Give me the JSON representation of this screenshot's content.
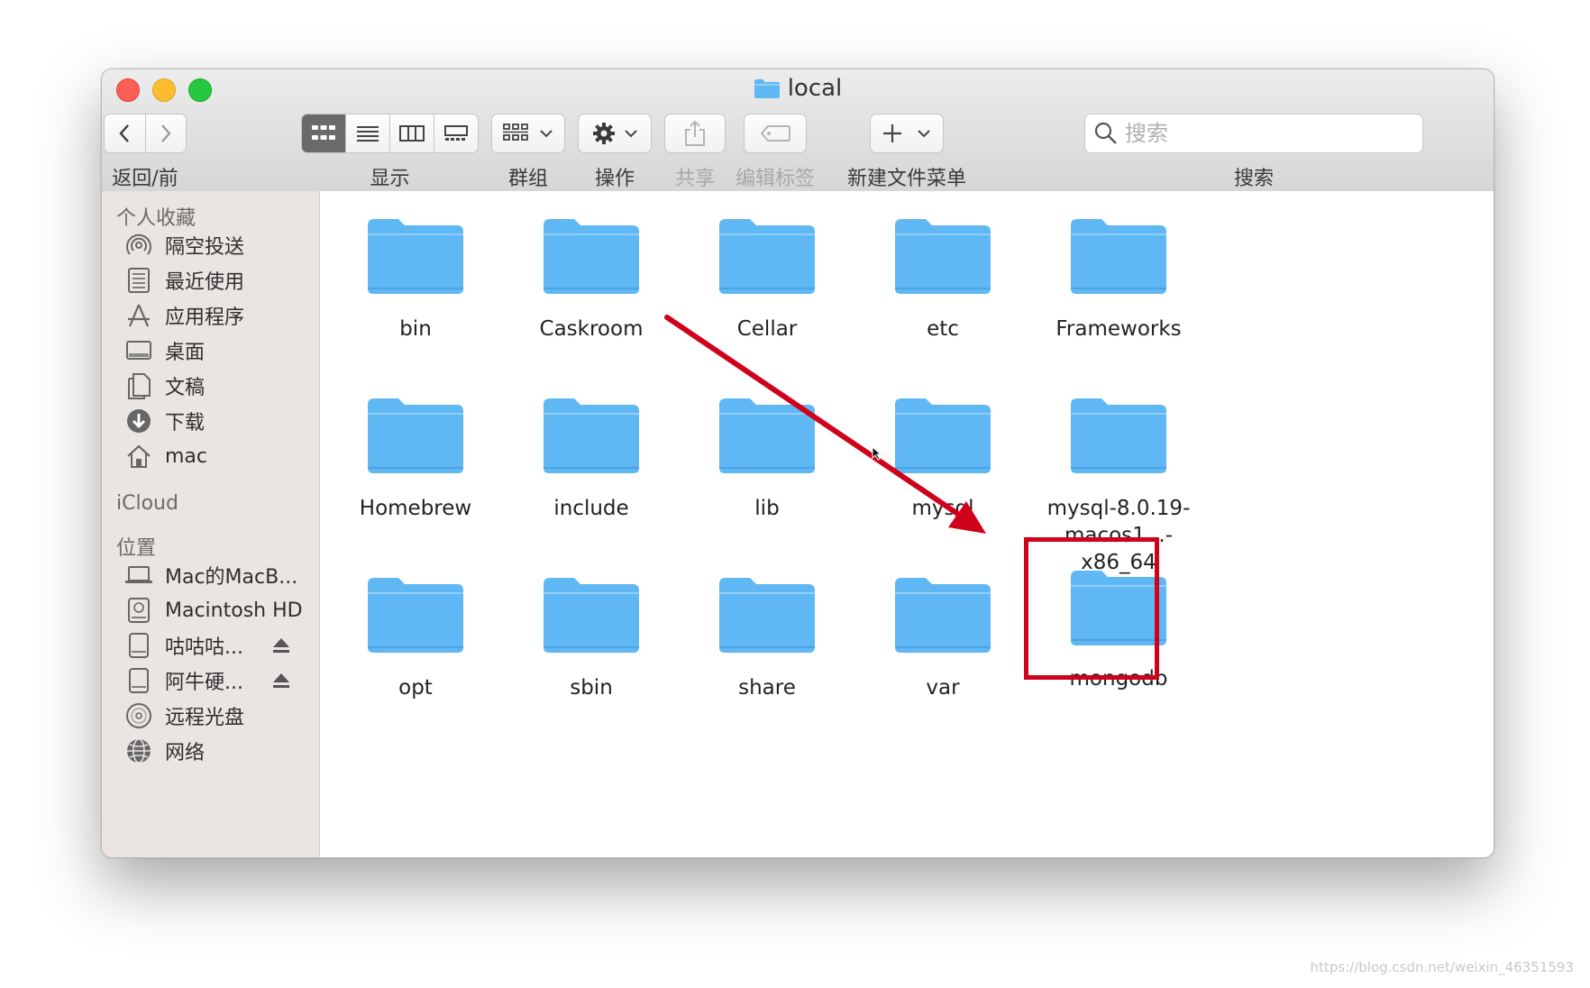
{
  "window": {
    "title": "local"
  },
  "toolbar": {
    "back_forward_label": "返回/前进",
    "view_label": "显示",
    "group_label": "群组",
    "action_label": "操作",
    "share_label": "共享",
    "tags_label": "编辑标签",
    "new_folder_menu_label": "新建文件菜单",
    "search_label": "搜索",
    "search_placeholder": "搜索",
    "active_view": "icon"
  },
  "sidebar": {
    "favorites_header": "个人收藏",
    "favorites": [
      {
        "label": "隔空投送",
        "icon": "airdrop-icon"
      },
      {
        "label": "最近使用",
        "icon": "recents-icon"
      },
      {
        "label": "应用程序",
        "icon": "applications-icon"
      },
      {
        "label": "桌面",
        "icon": "desktop-icon"
      },
      {
        "label": "文稿",
        "icon": "documents-icon"
      },
      {
        "label": "下载",
        "icon": "downloads-icon"
      },
      {
        "label": "mac",
        "icon": "home-icon"
      }
    ],
    "icloud_header": "iCloud",
    "locations_header": "位置",
    "locations": [
      {
        "label": "Mac的MacB...",
        "icon": "laptop-icon"
      },
      {
        "label": "Macintosh HD",
        "icon": "hard-drive-icon"
      },
      {
        "label": "咕咕咕...",
        "icon": "external-drive-icon",
        "eject": true
      },
      {
        "label": "阿牛硬...",
        "icon": "external-drive-icon",
        "eject": true
      },
      {
        "label": "远程光盘",
        "icon": "optical-disc-icon"
      },
      {
        "label": "网络",
        "icon": "network-icon"
      }
    ]
  },
  "files": [
    {
      "name": "bin"
    },
    {
      "name": "Caskroom"
    },
    {
      "name": "Cellar"
    },
    {
      "name": "etc"
    },
    {
      "name": "Frameworks"
    },
    {
      "name": "Homebrew"
    },
    {
      "name": "include"
    },
    {
      "name": "lib"
    },
    {
      "name": "mysql"
    },
    {
      "name": "mysql-8.0.19-\nmacos1...-x86_64"
    },
    {
      "name": "opt"
    },
    {
      "name": "sbin"
    },
    {
      "name": "share"
    },
    {
      "name": "var"
    },
    {
      "name": "mongodb"
    }
  ],
  "annotation": {
    "highlighted_item": "mongodb",
    "color": "#d0021b"
  },
  "colors": {
    "folder": "#5fb8f4",
    "sidebar_bg": "#eae4e2",
    "annotation": "#d0021b"
  },
  "watermark": "https://blog.csdn.net/weixin_46351593"
}
